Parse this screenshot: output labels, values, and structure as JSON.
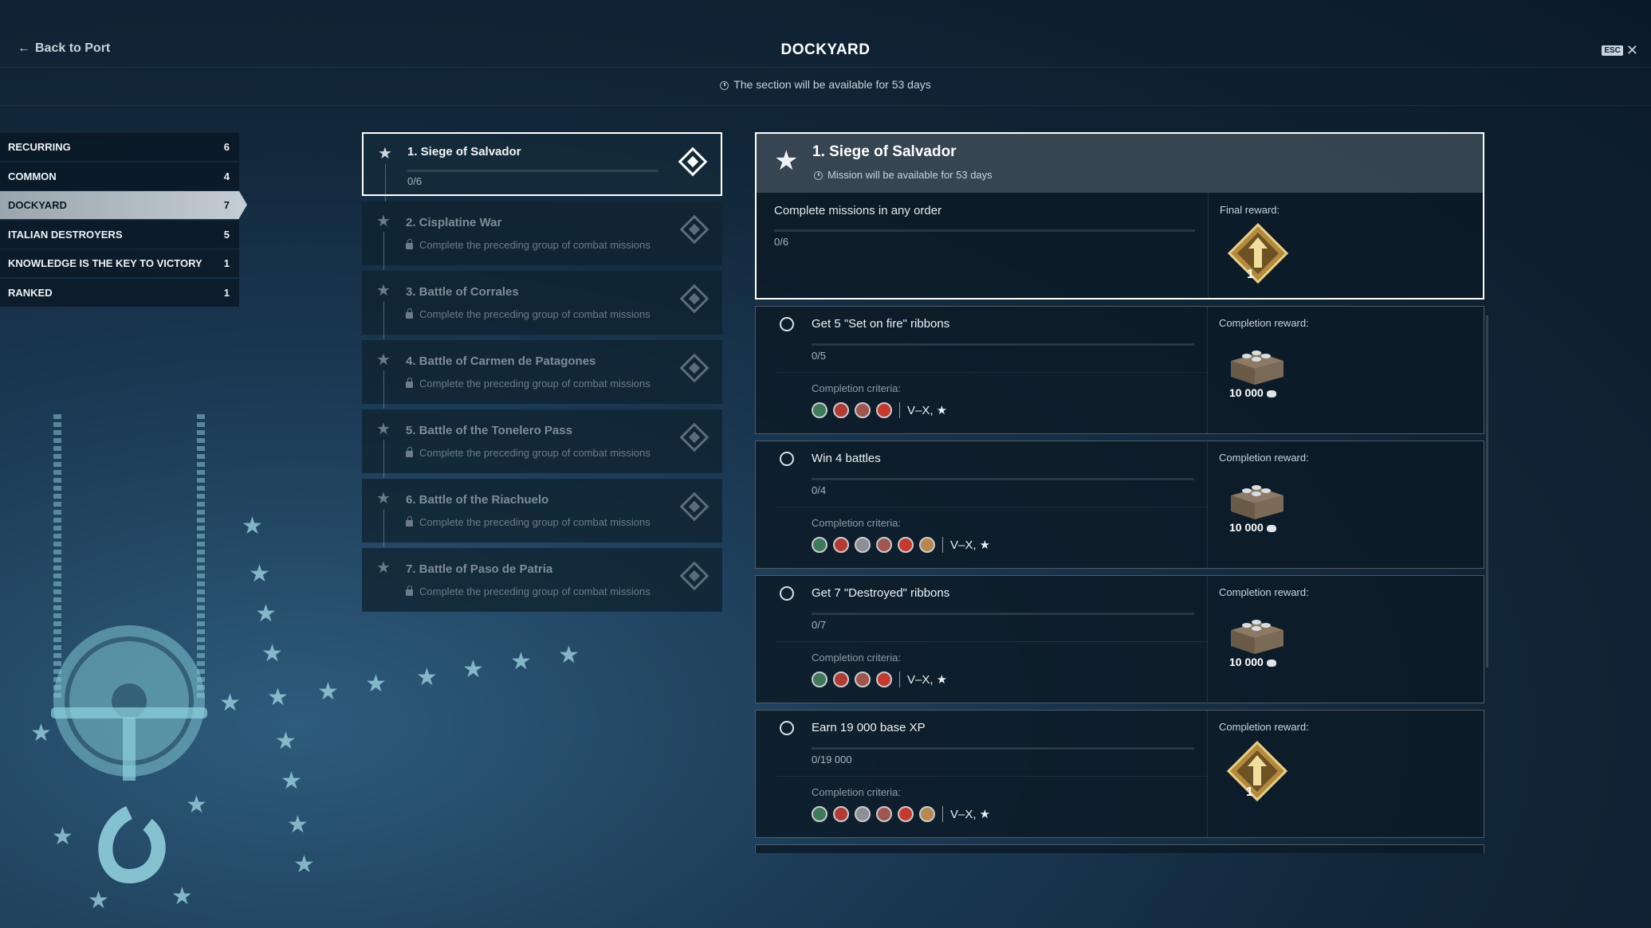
{
  "header": {
    "back_label": "Back to Port",
    "title": "DOCKYARD",
    "esc_label": "ESC",
    "availability": "The section will be available for 53 days"
  },
  "sidebar": {
    "items": [
      {
        "label": "RECURRING",
        "count": "6"
      },
      {
        "label": "COMMON",
        "count": "4"
      },
      {
        "label": "DOCKYARD",
        "count": "7"
      },
      {
        "label": "ITALIAN DESTROYERS",
        "count": "5"
      },
      {
        "label": "KNOWLEDGE IS THE KEY TO VICTORY",
        "count": "1"
      },
      {
        "label": "RANKED",
        "count": "1"
      }
    ],
    "active_index": 2
  },
  "groups": [
    {
      "name": "1. Siege of Salvador",
      "progress": "0/6",
      "locked": false
    },
    {
      "name": "2. Cisplatine War",
      "note": "Complete the preceding group of combat missions",
      "locked": true
    },
    {
      "name": "3. Battle of Corrales",
      "note": "Complete the preceding group of combat missions",
      "locked": true
    },
    {
      "name": "4. Battle of Carmen de Patagones",
      "note": "Complete the preceding group of combat missions",
      "locked": true
    },
    {
      "name": "5. Battle of the Tonelero Pass",
      "note": "Complete the preceding group of combat missions",
      "locked": true
    },
    {
      "name": "6. Battle of the Riachuelo",
      "note": "Complete the preceding group of combat missions",
      "locked": true
    },
    {
      "name": "7. Battle of Paso de Patria",
      "note": "Complete the preceding group of combat missions",
      "locked": true
    }
  ],
  "detail": {
    "title": "1. Siege of Salvador",
    "subtitle": "Mission will be available for 53 days",
    "description": "Complete missions in any order",
    "progress": "0/6",
    "final_reward_label": "Final reward:",
    "final_reward_count": "1"
  },
  "tasks": [
    {
      "name": "Get 5 \"Set on fire\" ribbons",
      "progress": "0/5",
      "criteria_label": "Completion criteria:",
      "classes": [
        "destroyer",
        "cruiser",
        "battleship",
        "carrier"
      ],
      "tiers": "V–X, ★",
      "reward_label": "Completion reward:",
      "reward_amount": "10 000",
      "reward_icon": "credits-crate"
    },
    {
      "name": "Win 4 battles",
      "progress": "0/4",
      "criteria_label": "Completion criteria:",
      "classes": [
        "destroyer",
        "cruiser",
        "aircraft",
        "battleship",
        "carrier",
        "submarine"
      ],
      "tiers": "V–X, ★",
      "reward_label": "Completion reward:",
      "reward_amount": "10 000",
      "reward_icon": "credits-crate"
    },
    {
      "name": "Get 7 \"Destroyed\" ribbons",
      "progress": "0/7",
      "criteria_label": "Completion criteria:",
      "classes": [
        "destroyer",
        "cruiser",
        "battleship",
        "carrier"
      ],
      "tiers": "V–X, ★",
      "reward_label": "Completion reward:",
      "reward_amount": "10 000",
      "reward_icon": "credits-crate"
    },
    {
      "name": "Earn 19 000 base XP",
      "progress": "0/19 000",
      "criteria_label": "Completion criteria:",
      "classes": [
        "destroyer",
        "cruiser",
        "aircraft",
        "battleship",
        "carrier",
        "submarine"
      ],
      "tiers": "V–X, ★",
      "reward_label": "Completion reward:",
      "reward_amount": "1",
      "reward_icon": "dockyard-phase-emblem"
    }
  ],
  "colors": {
    "accent": "#ffffff",
    "panel": "#0c1a26",
    "muted": "#7e8c97",
    "gold": "#c8a24a"
  }
}
